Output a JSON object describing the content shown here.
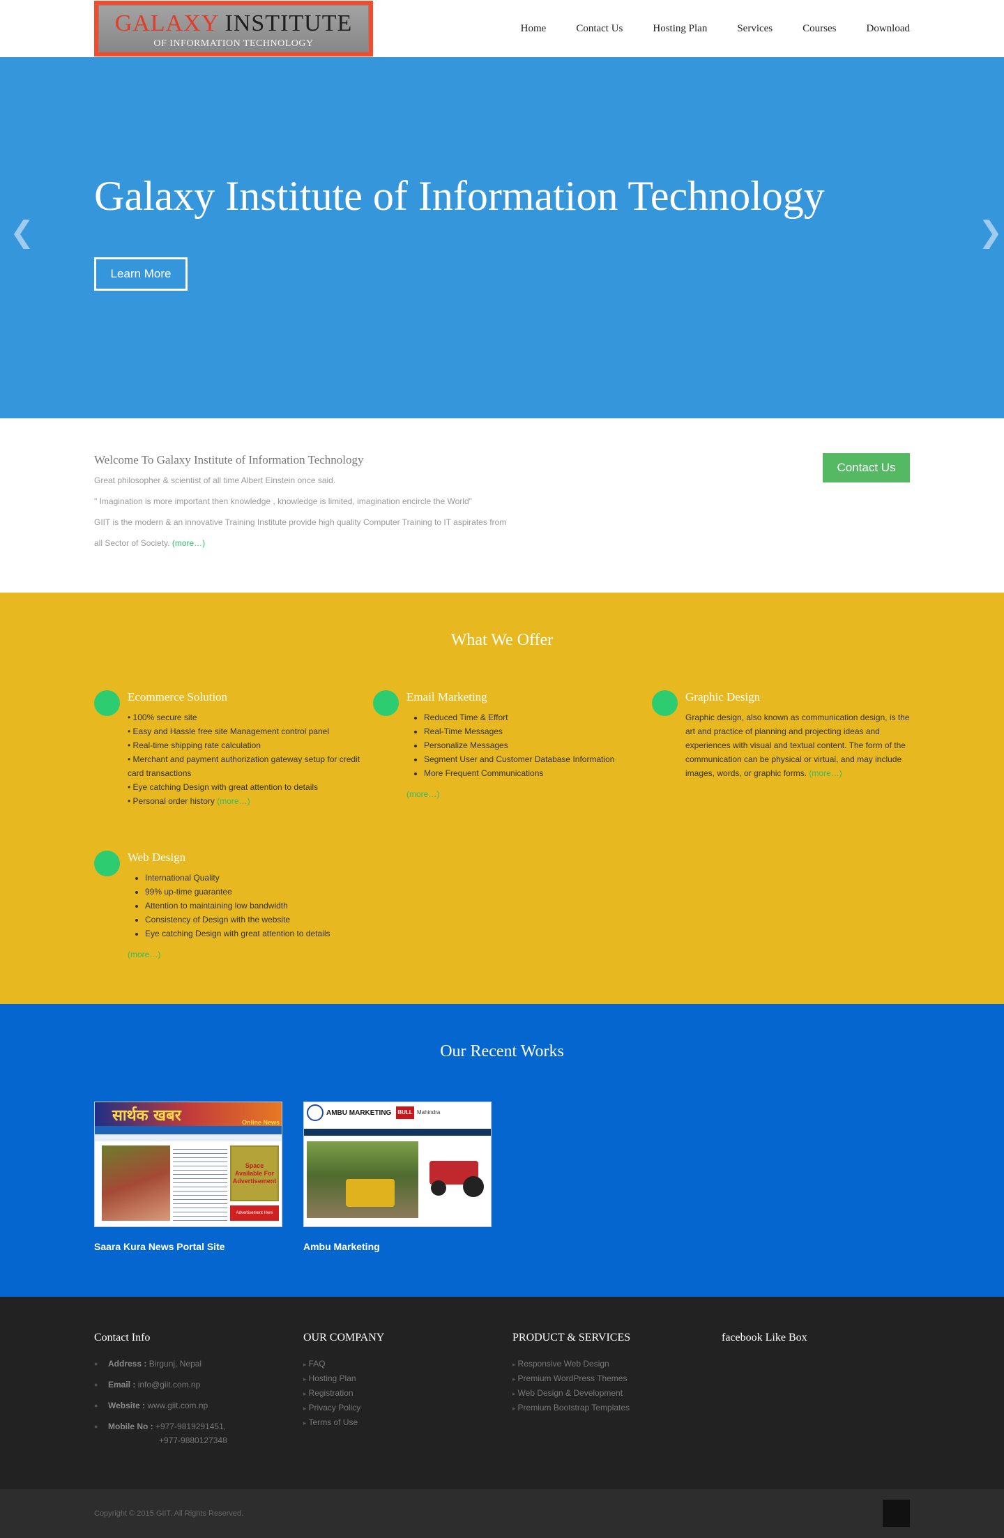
{
  "header": {
    "logo_line1_a": "GALAXY",
    "logo_line1_b": "INSTITUTE",
    "logo_line2": "OF INFORMATION TECHNOLOGY",
    "nav": [
      "Home",
      "Contact Us",
      "Hosting Plan",
      "Services",
      "Courses",
      "Download"
    ]
  },
  "hero": {
    "title": "Galaxy Institute of Information Technology",
    "button": "Learn More",
    "prev_icon": "chevron-left-icon",
    "next_icon": "chevron-right-icon",
    "prev_glyph": "❮",
    "next_glyph": "❯"
  },
  "welcome": {
    "title": "Welcome To Galaxy Institute of Information Technology",
    "p1": "Great philosopher & scientist of all time Albert Einstein once said.",
    "p2": "\" Imagination is more important then knowledge , knowledge is limited, imagination encircle the World\"",
    "p3": "GIIT is the modern & an innovative Training Institute provide high quality Computer Training to IT aspirates from",
    "p4": "all Sector of Society.",
    "more": "(more…)",
    "contact_button": "Contact Us"
  },
  "offer": {
    "title": "What We Offer",
    "icon_glyph": "",
    "ecommerce": {
      "title": "Ecommerce Solution",
      "items": [
        "• 100% secure site",
        "• Easy and Hassle free site Management control panel",
        "• Real-time shipping rate calculation",
        "• Merchant and payment authorization gateway setup for credit card transactions",
        "• Eye catching Design with great attention to details",
        "• Personal order history"
      ],
      "more": "(more…)"
    },
    "email": {
      "title": "Email Marketing",
      "items": [
        "Reduced Time & Effort",
        "Real-Time Messages",
        "Personalize Messages",
        "Segment User and Customer Database Information",
        "More Frequent Communications"
      ],
      "more": "(more…)"
    },
    "graphic": {
      "title": "Graphic Design",
      "text": "Graphic design, also known as communication design, is the art and practice of planning and projecting ideas and experiences with visual and textual content. The form of the communication can be physical or virtual, and may include images, words, or graphic forms.",
      "more": "(more…)"
    },
    "web": {
      "title": "Web Design",
      "items": [
        "International Quality",
        "99% up-time guarantee",
        "Attention to maintaining low bandwidth",
        "Consistency of Design with the website",
        "Eye catching Design with great attention to details"
      ],
      "more": "(more…)"
    }
  },
  "works": {
    "title": "Our Recent Works",
    "items": [
      {
        "caption": "Saara Kura News Portal Site",
        "thumb_title": "सार्थक खबर",
        "thumb_tag": "Online News",
        "thumb_ad": "Space Available For Advertisement",
        "thumb_ad2": "Advertisement Here"
      },
      {
        "caption": "Ambu Marketing",
        "thumb_title": "AMBU MARKETING",
        "thumb_brand": "Mahindra",
        "thumb_badge": "BULL"
      }
    ]
  },
  "footer": {
    "contact": {
      "title": "Contact Info",
      "address_label": "Address :",
      "address": "Birgunj, Nepal",
      "email_label": "Email :",
      "email": "info@giit.com.np",
      "website_label": "Website :",
      "website": "www.giit.com.np",
      "mobile_label": "Mobile No :",
      "mobile1": "+977-9819291451,",
      "mobile2": "+977-9880127348"
    },
    "company": {
      "title": "OUR COMPANY",
      "links": [
        "FAQ",
        "Hosting Plan",
        "Registration",
        "Privacy Policy",
        "Terms of Use"
      ]
    },
    "products": {
      "title": "PRODUCT & SERVICES",
      "links": [
        "Responsive Web Design",
        "Premium WordPress Themes",
        "Web Design & Development",
        "Premium Bootstrap Templates"
      ]
    },
    "facebook": {
      "title": "facebook Like Box"
    },
    "copyright": "Copyright © 2015 GIIT. All Rights Reserved.",
    "social_glyphs": [
      "",
      "",
      "",
      "",
      "",
      "",
      "",
      "",
      "",
      "",
      "",
      ""
    ],
    "totop_glyph": ""
  }
}
